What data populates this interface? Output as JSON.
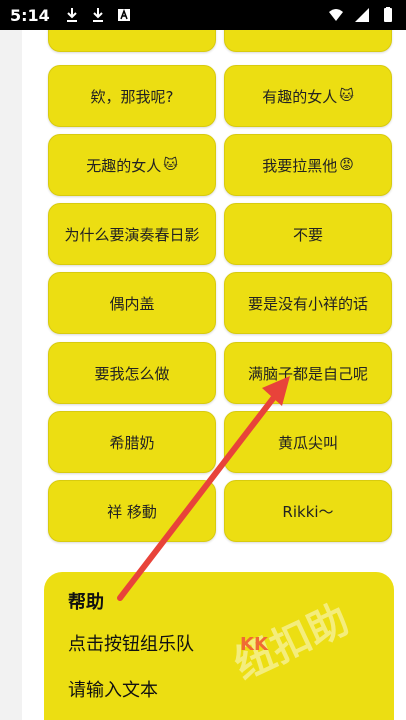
{
  "status_bar": {
    "time": "5:14",
    "icons_left": [
      "download-icon",
      "download-icon",
      "app-a-icon"
    ],
    "icons_right": [
      "wifi-icon",
      "signal-icon",
      "battery-icon"
    ]
  },
  "grid": {
    "top_row_partial": [
      "",
      ""
    ],
    "buttons": [
      {
        "label": "欸，那我呢?",
        "emoji": ""
      },
      {
        "label": "有趣的女人",
        "emoji": "🐱"
      },
      {
        "label": "无趣的女人",
        "emoji": "🐱"
      },
      {
        "label": "我要拉黑他",
        "emoji": "😡"
      },
      {
        "label": "为什么要演奏春日影",
        "emoji": ""
      },
      {
        "label": "不要",
        "emoji": ""
      },
      {
        "label": "偶内盖",
        "emoji": ""
      },
      {
        "label": "要是没有小祥的话",
        "emoji": ""
      },
      {
        "label": "要我怎么做",
        "emoji": ""
      },
      {
        "label": "满脑子都是自己呢",
        "emoji": ""
      },
      {
        "label": "希腊奶",
        "emoji": ""
      },
      {
        "label": "黄瓜尖叫",
        "emoji": ""
      },
      {
        "label": "祥 移動",
        "emoji": ""
      },
      {
        "label": "Rikki～",
        "emoji": ""
      }
    ]
  },
  "help": {
    "title": "帮助",
    "line1": "点击按钮组乐队",
    "line2": "请输入文本"
  },
  "watermark": {
    "text": "纽扣助",
    "logo": "KK"
  },
  "colors": {
    "button_yellow": "#ecde12",
    "arrow_red": "#e8433a",
    "status_bar": "#000000"
  }
}
